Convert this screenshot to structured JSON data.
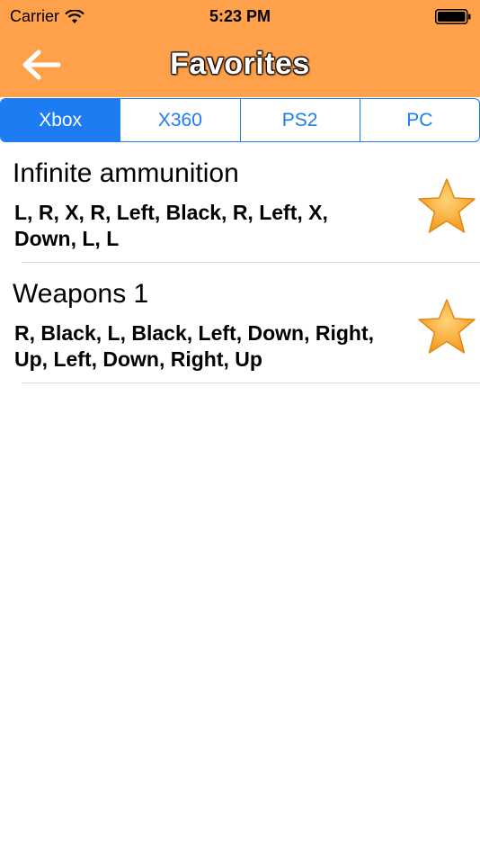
{
  "status_bar": {
    "carrier": "Carrier",
    "time": "5:23 PM"
  },
  "nav": {
    "title": "Favorites",
    "back_icon": "arrow-left-icon"
  },
  "segments": [
    {
      "label": "Xbox",
      "selected": true
    },
    {
      "label": "X360",
      "selected": false
    },
    {
      "label": "PS2",
      "selected": false
    },
    {
      "label": "PC",
      "selected": false
    }
  ],
  "favorites": [
    {
      "title": "Infinite ammunition",
      "code": "L, R, X, R, Left, Black, R, Left, X, Down, L, L",
      "icon": "star-icon"
    },
    {
      "title": "Weapons 1",
      "code": "R, Black, L, Black, Left, Down, Right, Up, Left, Down, Right, Up",
      "icon": "star-icon"
    }
  ],
  "colors": {
    "header": "#FFA04A",
    "accent": "#1E7CF2",
    "star": "#F9A82A"
  }
}
